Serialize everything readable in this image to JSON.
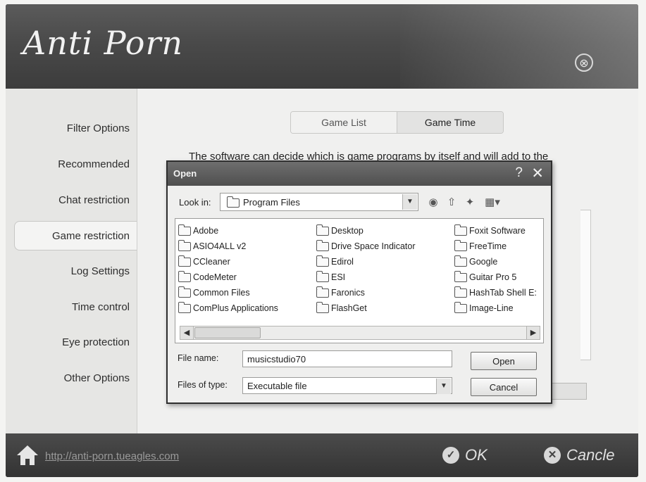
{
  "app": {
    "title": "Anti Porn",
    "close_glyph": "⊗"
  },
  "sidebar": {
    "items": [
      {
        "label": "Filter Options"
      },
      {
        "label": "Recommended"
      },
      {
        "label": "Chat restriction"
      },
      {
        "label": "Game restriction",
        "active": true
      },
      {
        "label": "Log Settings"
      },
      {
        "label": "Time control"
      },
      {
        "label": "Eye protection"
      },
      {
        "label": "Other Options"
      }
    ]
  },
  "main": {
    "tabs": [
      {
        "label": "Game List"
      },
      {
        "label": "Game Time"
      }
    ],
    "description": "The software can decide which is game programs by itself and will add  to the"
  },
  "footer": {
    "url": "http://anti-porn.tueagles.com",
    "ok_label": "OK",
    "cancel_label": "Cancle"
  },
  "dialog": {
    "title": "Open",
    "help_glyph": "?",
    "close_glyph": "✕",
    "look_in_label": "Look in:",
    "look_in_value": "Program Files",
    "columns": [
      [
        "Adobe",
        "ASIO4ALL v2",
        "CCleaner",
        "CodeMeter",
        "Common Files",
        "ComPlus Applications"
      ],
      [
        "Desktop",
        "Drive Space Indicator",
        "Edirol",
        "ESI",
        "Faronics",
        "FlashGet"
      ],
      [
        "Foxit Software",
        "FreeTime",
        "Google",
        "Guitar Pro 5",
        "HashTab Shell E:",
        "Image-Line"
      ]
    ],
    "file_name_label": "File name:",
    "file_name_value": "musicstudio70",
    "file_type_label": "Files of type:",
    "file_type_value": "Executable file",
    "open_label": "Open",
    "cancel_label": "Cancel"
  },
  "colors": {
    "header": "#4a4a4a",
    "footer": "#333333",
    "panel": "#ebebea"
  }
}
